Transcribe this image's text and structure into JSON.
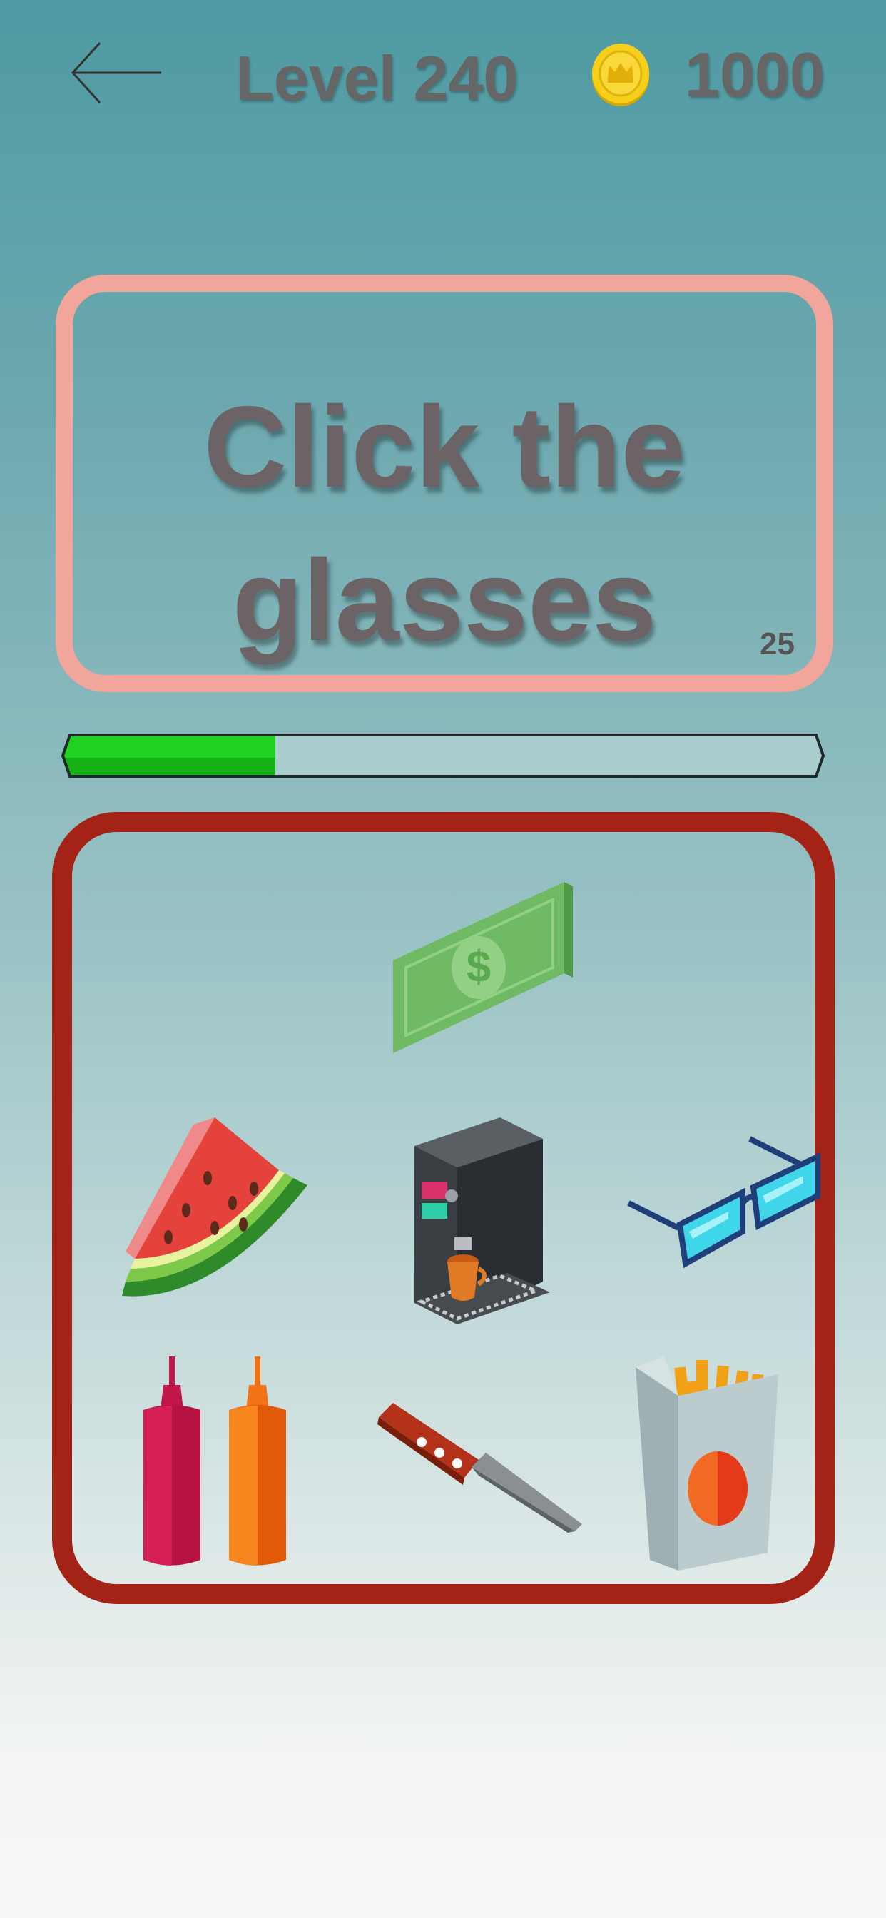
{
  "header": {
    "back_icon": "arrow-left-icon",
    "level_label": "Level 240",
    "coin_icon": "gold-coin-crown-icon",
    "coin_count": "1000"
  },
  "question": {
    "line1": "Click the",
    "line2": "glasses",
    "timer": "25"
  },
  "progress": {
    "fraction": 0.28,
    "fill_color": "#1fd21f"
  },
  "board": {
    "items": [
      {
        "name": "money-bill",
        "icon": "dollar-bill-icon"
      },
      {
        "name": "watermelon-slice",
        "icon": "watermelon-icon"
      },
      {
        "name": "coffee-machine",
        "icon": "coffee-machine-icon"
      },
      {
        "name": "glasses",
        "icon": "glasses-icon"
      },
      {
        "name": "sauce-bottles",
        "icon": "ketchup-mustard-icon"
      },
      {
        "name": "knife",
        "icon": "knife-icon"
      },
      {
        "name": "french-fries",
        "icon": "fries-icon"
      }
    ]
  },
  "colors": {
    "question_border": "#f2a59a",
    "board_border": "#a52217",
    "text": "#666666"
  }
}
